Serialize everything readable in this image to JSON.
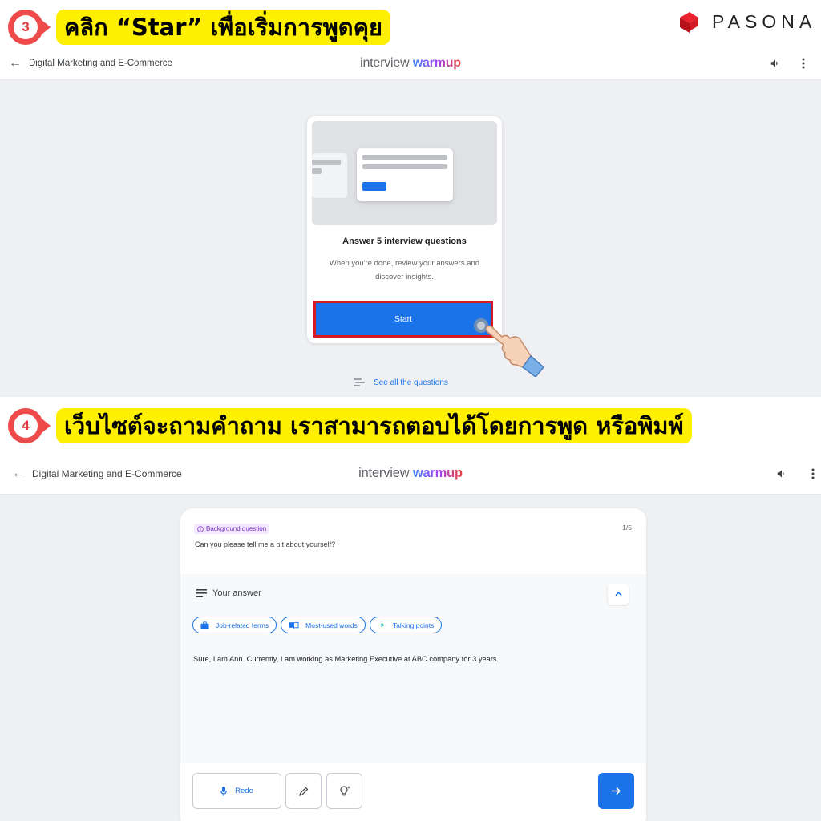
{
  "steps": [
    {
      "number": "3",
      "text": "คลิก “Star” เพื่อเริ่มการพูดคุย"
    },
    {
      "number": "4",
      "text": "เว็บไซต์จะถามคำถาม เราสามารถตอบได้โดยการพูด หรือพิมพ์"
    }
  ],
  "logo": {
    "text": "PASONA"
  },
  "appbar": {
    "breadcrumb": "Digital Marketing and E-Commerce",
    "brand_prefix": "interview ",
    "brand_suffix": "warmup",
    "volume_icon": "volume-icon",
    "menu_icon": "more-vert-icon"
  },
  "intro_card": {
    "title": "Answer 5 interview questions",
    "description": "When you're done, review your answers and discover insights.",
    "start_label": "Start",
    "see_all_label": "See all the questions"
  },
  "question_card": {
    "badge": "Background question",
    "progress": "1/5",
    "question": "Can you please tell me a bit about yourself?",
    "answer_heading": "Your answer",
    "chips": [
      {
        "label": "Job-related terms",
        "icon": "briefcase-icon"
      },
      {
        "label": "Most-used words",
        "icon": "book-icon"
      },
      {
        "label": "Talking points",
        "icon": "sparkle-icon"
      }
    ],
    "answer_text": "Sure, I am Ann. Currently, I am working as Marketing Executive at ABC company for 3 years.",
    "redo_label": "Redo"
  },
  "colors": {
    "accent": "#1a73e8",
    "highlight": "#ffef00",
    "step_badge": "#ef4a4a",
    "start_outline": "#d71920",
    "background": "#eef0f3"
  }
}
